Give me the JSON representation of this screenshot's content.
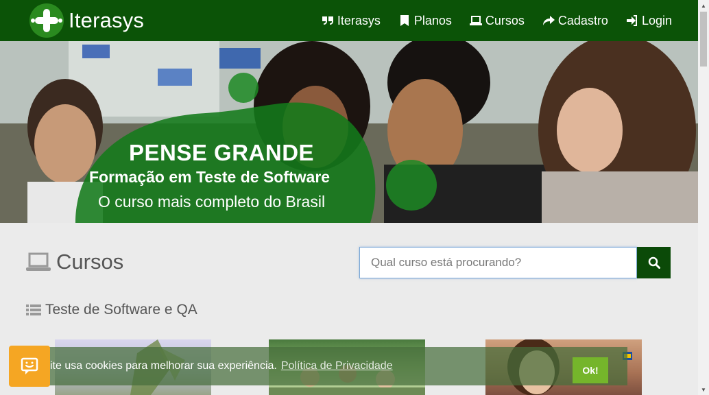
{
  "navbar": {
    "brand": "Iterasys",
    "items": [
      {
        "label": "Iterasys",
        "icon": "quote-icon"
      },
      {
        "label": "Planos",
        "icon": "bookmark-icon"
      },
      {
        "label": "Cursos",
        "icon": "laptop-icon"
      },
      {
        "label": "Cadastro",
        "icon": "share-arrow-icon"
      },
      {
        "label": "Login",
        "icon": "sign-in-icon"
      }
    ]
  },
  "hero": {
    "title": "PENSE GRANDE",
    "subtitle": "Formação em Teste de Software",
    "tagline": "O curso mais completo do Brasil"
  },
  "main": {
    "section_title": "Cursos",
    "search": {
      "placeholder": "Qual curso está procurando?",
      "value": ""
    },
    "category": "Teste de Software e QA"
  },
  "cookie": {
    "text": "ite usa cookies para melhorar sua experiência.",
    "link": "Política de Privacidade",
    "ok": "Ok!"
  },
  "colors": {
    "navbar": "#0b5307",
    "search_button": "#0b4a08",
    "cookie_ok": "#75b52b",
    "cookie_badge": "#f5a623"
  }
}
